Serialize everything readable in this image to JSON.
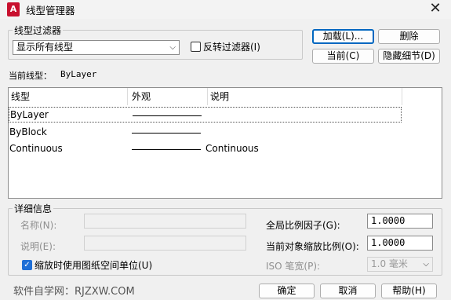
{
  "window": {
    "app_icon": "A",
    "title": "线型管理器",
    "close_glyph": "✕"
  },
  "filter": {
    "group_label": "线型过滤器",
    "selected": "显示所有线型",
    "invert_checked": false,
    "invert_label": "反转过滤器(I)"
  },
  "buttons": {
    "load": "加载(L)...",
    "delete": "删除",
    "current": "当前(C)",
    "hide_details": "隐藏细节(D)",
    "ok": "确定",
    "cancel": "取消",
    "help": "帮助(H)"
  },
  "current_linetype": {
    "label": "当前线型：",
    "value": "ByLayer"
  },
  "table": {
    "headers": [
      "线型",
      "外观",
      "说明"
    ],
    "rows": [
      {
        "name": "ByLayer",
        "description": ""
      },
      {
        "name": "ByBlock",
        "description": ""
      },
      {
        "name": "Continuous",
        "description": "Continuous"
      }
    ]
  },
  "details": {
    "group_label": "详细信息",
    "name_label": "名称(N):",
    "desc_label": "说明(E):",
    "paper_units_checked": true,
    "paper_units_label": "缩放时使用图纸空间单位(U)",
    "global_scale_label": "全局比例因子(G):",
    "global_scale_value": "1.0000",
    "current_scale_label": "当前对象缩放比例(O):",
    "current_scale_value": "1.0000",
    "iso_pen_label": "ISO 笔宽(P):",
    "iso_pen_value": "1.0 毫米"
  },
  "watermark": "软件自学网：RJZXW.COM",
  "icons": {
    "dropdown": "chevron-down-icon",
    "check": "checkmark-icon",
    "close": "close-icon"
  },
  "colors": {
    "accent": "#0067c0",
    "app_icon": "#c8102e",
    "checkbox": "#1f6fd6"
  }
}
